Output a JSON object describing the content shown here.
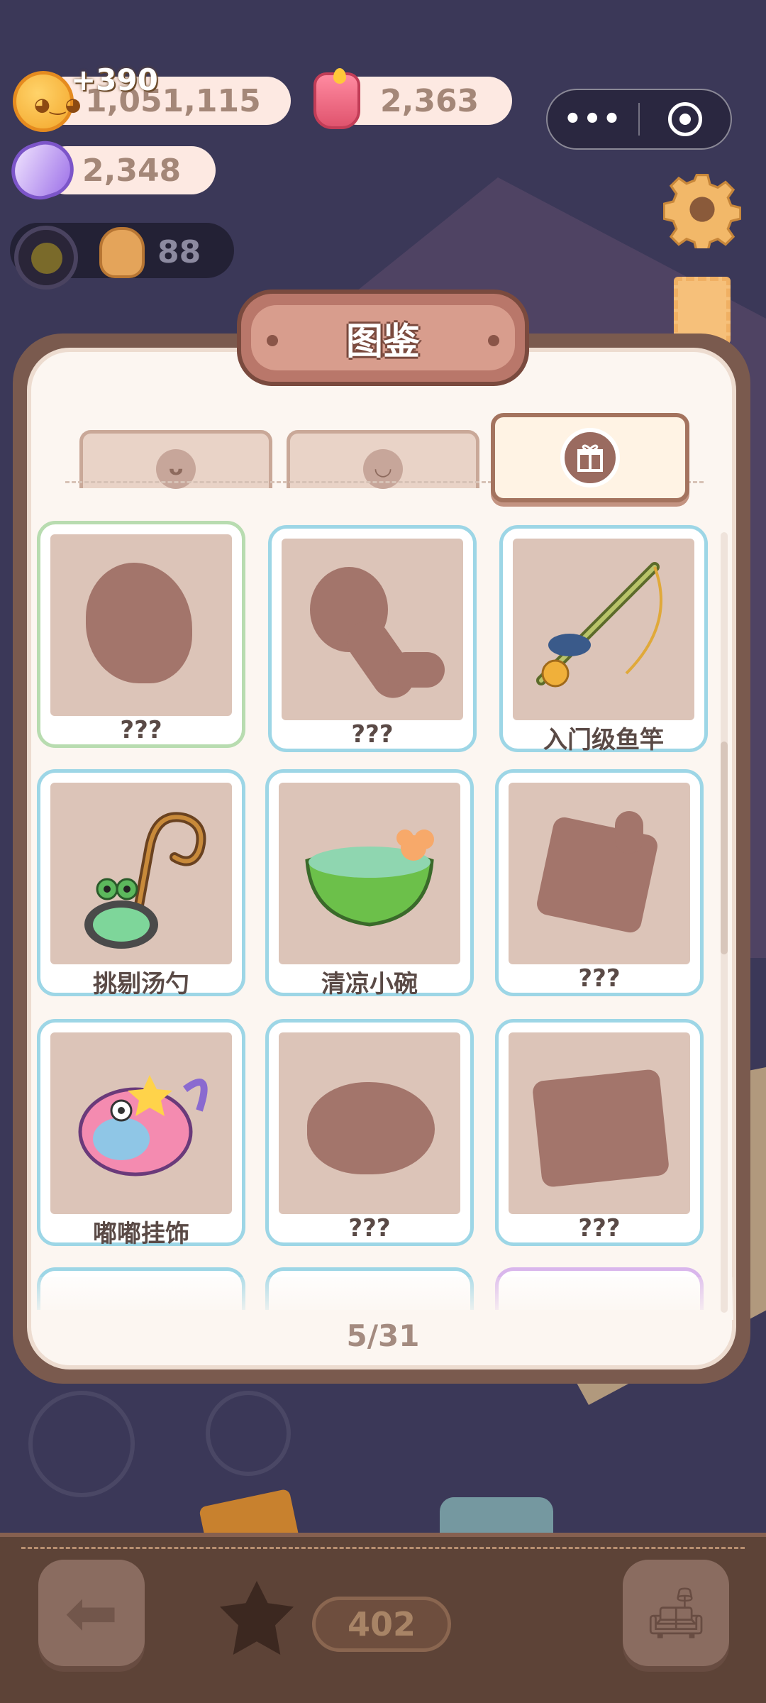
{
  "hud": {
    "coins": "1,051,115",
    "coins_gain": "+390",
    "candles": "2,363",
    "crystals": "2,348",
    "level_value": "88",
    "menu_dots": "•••"
  },
  "panel": {
    "title": "图鉴",
    "counter": "5/31"
  },
  "tabs": [
    {
      "icon": "gingerbread-icon",
      "glyph": "ᴗ"
    },
    {
      "icon": "chef-icon",
      "glyph": "◡"
    },
    {
      "icon": "gift-icon",
      "glyph": "🎁"
    }
  ],
  "items": [
    {
      "label": "???",
      "discovered": false,
      "frame": "green"
    },
    {
      "label": "???",
      "discovered": false,
      "frame": "blue"
    },
    {
      "label": "入门级鱼竿",
      "discovered": true,
      "frame": "blue"
    },
    {
      "label": "挑剔汤勺",
      "discovered": true,
      "frame": "blue"
    },
    {
      "label": "清凉小碗",
      "discovered": true,
      "frame": "blue"
    },
    {
      "label": "???",
      "discovered": false,
      "frame": "blue"
    },
    {
      "label": "嘟嘟挂饰",
      "discovered": true,
      "frame": "blue"
    },
    {
      "label": "???",
      "discovered": false,
      "frame": "blue"
    },
    {
      "label": "???",
      "discovered": false,
      "frame": "blue"
    }
  ],
  "bottom": {
    "count": "402"
  },
  "colors": {
    "background": "#3b3858",
    "panel_border": "#7a5a4e",
    "card_frame_blue": "#9dd6e6",
    "card_frame_green": "#b8dcb0",
    "silhouette": "#a3756b"
  }
}
